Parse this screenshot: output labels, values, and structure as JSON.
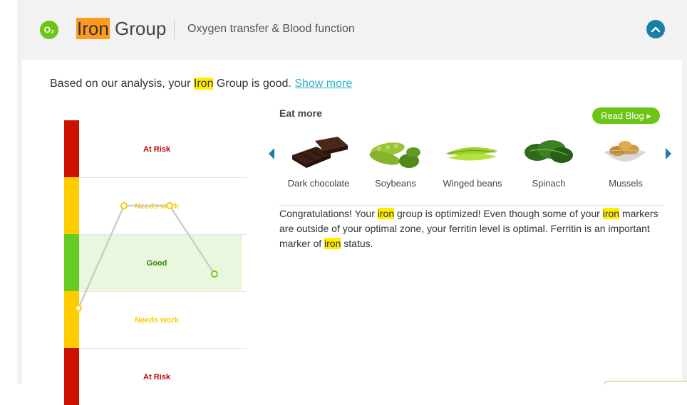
{
  "header": {
    "icon_label": "O₂",
    "title_highlight": "Iron",
    "title_rest": " Group",
    "subtitle": "Oxygen transfer & Blood function"
  },
  "analysis": {
    "prefix": "Based on our analysis, your ",
    "highlight": "Iron",
    "suffix": " Group is good. ",
    "show_more": "Show more"
  },
  "chart_data": {
    "type": "line",
    "zones": [
      "At Risk",
      "Needs work",
      "Good",
      "Needs work",
      "At Risk"
    ],
    "zone_colors": [
      "#cc1100",
      "#ffcc00",
      "#66cc22",
      "#ffcc00",
      "#cc1100"
    ],
    "label_colors": [
      "#c00000",
      "#ffcc00",
      "#338800",
      "#ffcc00",
      "#c00000"
    ],
    "y": [
      1.7,
      3.5,
      3.5,
      2.3
    ],
    "ylim": [
      0,
      5
    ],
    "highlight_zone": "Good",
    "line_color": "#cccccc",
    "point_stroke_color": "#ffcc00"
  },
  "eat_more": {
    "label": "Eat more",
    "read_blog": "Read Blog",
    "foods": [
      {
        "name": "Dark chocolate",
        "icon": "dark-chocolate-icon"
      },
      {
        "name": "Soybeans",
        "icon": "soybeans-icon"
      },
      {
        "name": "Winged beans",
        "icon": "winged-beans-icon"
      },
      {
        "name": "Spinach",
        "icon": "spinach-icon"
      },
      {
        "name": "Mussels",
        "icon": "mussels-icon"
      }
    ]
  },
  "summary": {
    "t1": "Congratulations! Your ",
    "hl1": "iron",
    "t2": " group is optimized! Even though some of your ",
    "hl2": "iron",
    "t3": " markers are outside of your optimal zone, your ferritin level is optimal. Ferritin is an important marker of ",
    "hl3": "iron",
    "t4": " status."
  },
  "colors": {
    "accent_green": "#6cc417",
    "accent_blue": "#1a7fa8",
    "highlight_orange": "#ff9a1f",
    "highlight_yellow": "#ffee00",
    "link_teal": "#2bb3c9"
  }
}
